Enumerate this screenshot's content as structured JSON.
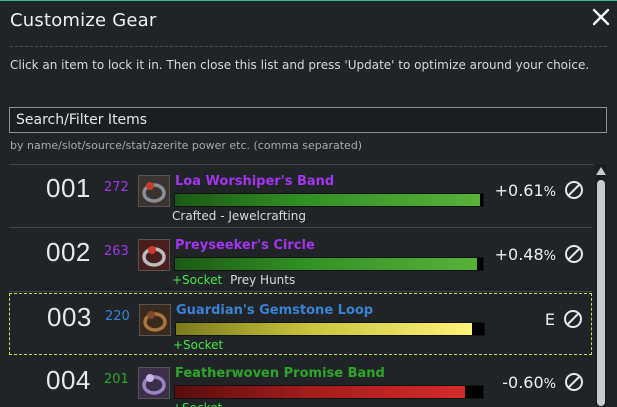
{
  "dialog": {
    "title": "Customize Gear",
    "instructions": "Click an item to lock it in. Then close this list and press 'Update' to optimize around your choice.",
    "search_placeholder": "Search/Filter Items",
    "search_hint": "by name/slot/source/stat/azerite power etc. (comma separated)"
  },
  "colors": {
    "accent": "#2fbf8f",
    "epic": "#a335ee",
    "rare": "#3a82d6",
    "uncommon": "#1eff00",
    "socket": "#46e84a",
    "locked_border": "#bfe35a"
  },
  "items": [
    {
      "rank": "001",
      "ilvl": "272",
      "ilvl_color": "#a335ee",
      "name": "Loa Worshiper's Band",
      "name_color": "#a335ee",
      "icon": "ring-icon",
      "bar_fill": 0.99,
      "bar_color": "linear-gradient(90deg,#1c5a17,#2f8f22 40%,#58b23a)",
      "socket": "",
      "source": "Crafted - Jewelcrafting",
      "delta": "+0.61",
      "delta_unit": "%",
      "locked": false
    },
    {
      "rank": "002",
      "ilvl": "263",
      "ilvl_color": "#a335ee",
      "name": "Preyseeker's Circle",
      "name_color": "#a335ee",
      "icon": "ring-icon",
      "bar_fill": 0.98,
      "bar_color": "linear-gradient(90deg,#1c5a17,#2f8f22 40%,#58b23a)",
      "socket": "+Socket",
      "source": "Prey Hunts",
      "delta": "+0.48",
      "delta_unit": "%",
      "locked": false
    },
    {
      "rank": "003",
      "ilvl": "220",
      "ilvl_color": "#3a82d6",
      "name": "Guardian's Gemstone Loop",
      "name_color": "#3a82d6",
      "icon": "ring-icon",
      "bar_fill": 0.96,
      "bar_color": "linear-gradient(90deg,#7a7a1c,#c9c43c 45%,#fff27a)",
      "socket": "+Socket",
      "source": "",
      "delta": "E",
      "delta_unit": "",
      "locked": true
    },
    {
      "rank": "004",
      "ilvl": "201",
      "ilvl_color": "#2ea62a",
      "name": "Featherwoven Promise Band",
      "name_color": "#2ea62a",
      "icon": "ring-icon",
      "bar_fill": 0.94,
      "bar_color": "linear-gradient(90deg,#5a0d0d,#a31c1c 45%,#d52a2a)",
      "socket": "+Socket",
      "source": "",
      "delta": "-0.60",
      "delta_unit": "%",
      "locked": false
    }
  ]
}
